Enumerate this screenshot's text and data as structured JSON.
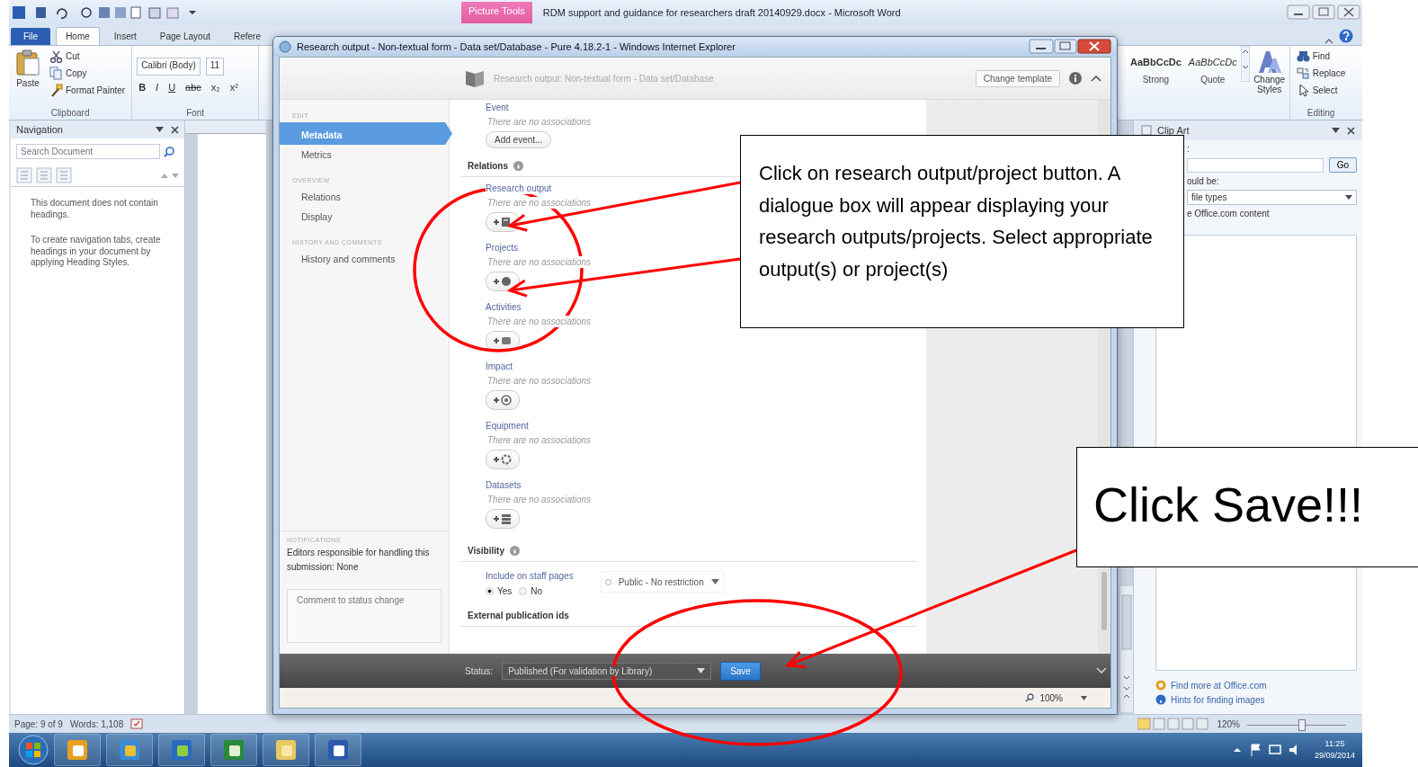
{
  "word": {
    "title": "RDM support and guidance for researchers draft 20140929.docx - Microsoft Word",
    "contextual_tab": "Picture Tools",
    "file_button": "File",
    "tabs": [
      {
        "label": "Home",
        "selected": true
      },
      {
        "label": "Insert",
        "selected": false
      },
      {
        "label": "Page Layout",
        "selected": false
      },
      {
        "label": "Refere",
        "selected": false
      }
    ],
    "clipboard": {
      "paste": "Paste",
      "items": [
        {
          "label": "Cut",
          "kind": "cut"
        },
        {
          "label": "Copy",
          "kind": "copy"
        },
        {
          "label": "Format Painter",
          "kind": "painter"
        }
      ],
      "group": "Clipboard"
    },
    "font": {
      "name": "Calibri (Body)",
      "size": "11",
      "buttons": [
        {
          "label": "B",
          "kind": "bold"
        },
        {
          "label": "I",
          "kind": "italic"
        },
        {
          "label": "U",
          "kind": "underline"
        },
        {
          "label": "abc",
          "kind": "strike"
        },
        {
          "label": "x₂",
          "kind": "plain"
        },
        {
          "label": "x²",
          "kind": "plain"
        }
      ],
      "group": "Font"
    },
    "styles": [
      {
        "sample": "AaBbCcDc",
        "name": "Strong",
        "kind": "strong"
      },
      {
        "sample": "AaBbCcDc",
        "name": "Quote",
        "kind": "quote"
      }
    ],
    "change_styles": "Change Styles",
    "editing": {
      "items": [
        {
          "label": "Find",
          "kind": "find"
        },
        {
          "label": "Replace",
          "kind": "replace"
        },
        {
          "label": "Select",
          "kind": "select"
        }
      ],
      "group": "Editing"
    },
    "navigation": {
      "title": "Navigation",
      "search_placeholder": "Search Document",
      "messages": [
        "This document does not contain headings.",
        "To create navigation tabs, create headings in your document by applying Heading Styles."
      ]
    },
    "clip_art": {
      "title": "Clip Art",
      "search_label": ":",
      "go": "Go",
      "results_label": "ould be:",
      "file_types": "file types",
      "include": "e Office.com content",
      "links": [
        {
          "label": "Find more at Office.com",
          "kind": "office"
        },
        {
          "label": "Hints for finding images",
          "kind": "help"
        }
      ]
    },
    "status_bar": {
      "page": "Page: 9 of 9",
      "words": "Words: 1,108",
      "zoom": "120%",
      "zoom_slider": {
        "level": 0.55
      }
    }
  },
  "ie": {
    "title": "Research output - Non-textual form - Data set/Database - Pure 4.18.2-1 - Windows Internet Explorer",
    "breadcrumb": "Research output: Non-textual form - Data set/Database",
    "change_template": "Change template",
    "sidebar": [
      {
        "heading": "EDIT",
        "items": [
          {
            "label": "Metadata",
            "selected": true
          },
          {
            "label": "Metrics",
            "selected": false
          }
        ]
      },
      {
        "heading": "OVERVIEW",
        "items": [
          {
            "label": "Relations",
            "selected": false
          },
          {
            "label": "Display",
            "selected": false
          }
        ]
      },
      {
        "heading": "HISTORY AND COMMENTS",
        "items": [
          {
            "label": "History and comments",
            "selected": false
          }
        ]
      }
    ],
    "notifications": {
      "heading": "NOTIFICATIONS",
      "text": "Editors responsible for handling this submission: None"
    },
    "comment": {
      "placeholder": "Comment to status change"
    },
    "form": {
      "event": {
        "label": "Event",
        "empty": "There are no associations",
        "button": "Add event..."
      },
      "relations_heading": "Relations",
      "relations": [
        {
          "label": "Research output",
          "empty": "There are no associations",
          "kind": "output"
        },
        {
          "label": "Projects",
          "empty": "There are no associations",
          "kind": "project"
        },
        {
          "label": "Activities",
          "empty": "There are no associations",
          "kind": "activity"
        },
        {
          "label": "Impact",
          "empty": "There are no associations",
          "kind": "impact"
        },
        {
          "label": "Equipment",
          "empty": "There are no associations",
          "kind": "equipment"
        },
        {
          "label": "Datasets",
          "empty": "There are no associations",
          "kind": "dataset"
        }
      ],
      "visibility_heading": "Visibility",
      "include_label": "Include on staff pages",
      "options": [
        {
          "label": "Yes",
          "selected": true
        },
        {
          "label": "No",
          "selected": false
        }
      ],
      "visibility_select": "Public - No restriction",
      "external_heading": "External publication ids"
    },
    "footer": {
      "status_label": "Status:",
      "status_value": "Published (For validation by Library)",
      "save": "Save"
    },
    "zoom": "100%"
  },
  "callouts": [
    {
      "text": "Click on research output/project button.  A dialogue box will appear displaying your research outputs/projects.  Select appropriate output(s) or project(s)"
    },
    {
      "text": "Click Save!!!"
    }
  ],
  "taskbar": {
    "time": "11:25",
    "date": "29/09/2014"
  }
}
